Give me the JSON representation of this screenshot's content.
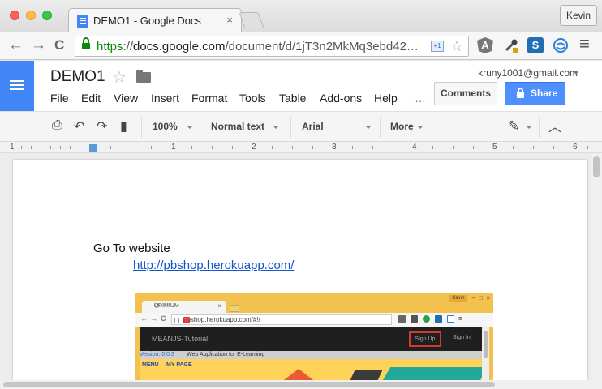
{
  "browser": {
    "tab_title": "DEMO1 - Google Docs",
    "tab_close": "×",
    "profile_name": "Kevin",
    "back_glyph": "←",
    "forward_glyph": "→",
    "reload_glyph": "C",
    "url_secure": "https",
    "url_sep": "://",
    "url_host": "docs.google.com",
    "url_path": "/document/d/1jT3n2MkMq3ebd42…",
    "omnibox_ext_label": "+1",
    "star_glyph": "☆",
    "extensions": [
      {
        "name": "angularjs-batarang",
        "label": "A",
        "color": "#7a7a7a"
      },
      {
        "name": "eyedropper",
        "label": "",
        "color": "#c9a227"
      },
      {
        "name": "scribefire",
        "label": "S",
        "color": "#1f6fb2"
      },
      {
        "name": "sync",
        "label": "",
        "color": "#2f7fd8"
      }
    ],
    "menu_glyph": "≡"
  },
  "docs": {
    "title": "DEMO1",
    "title_star": "☆",
    "menu": [
      "File",
      "Edit",
      "View",
      "Insert",
      "Format",
      "Tools",
      "Table",
      "Add-ons",
      "Help",
      "…"
    ],
    "account": "kruny1001@gmail.com",
    "comments_label": "Comments",
    "share_label": "Share",
    "colors": {
      "brand": "#4285f4",
      "share": "#4d90fe",
      "link": "#1155cc"
    }
  },
  "format_toolbar": {
    "print_glyph": "⎙",
    "undo_glyph": "↶",
    "redo_glyph": "↷",
    "paint_glyph": "▮",
    "zoom": "100%",
    "style": "Normal text",
    "font": "Arial",
    "more": "More",
    "pen_glyph": "✎",
    "collapse_glyph": "︿"
  },
  "ruler": {
    "numbers": [
      "1",
      "1",
      "2",
      "3",
      "4",
      "5",
      "6"
    ]
  },
  "document": {
    "line1": "Go To website",
    "link": "http://pbshop.herokuapp.com/"
  },
  "embedded_screenshot": {
    "tab_title": "URIMIUM",
    "tab_close": "×",
    "profile": "Kevin",
    "win_min": "–",
    "win_max": "□",
    "win_close": "×",
    "url": "pbshop.herokuapp.com/#!/",
    "brand": "MEANJS-Tutorial",
    "sign_up": "Sign Up",
    "sign_in": "Sign In",
    "version": "Version: 0.0.3",
    "description": "Web Application for E-Learning",
    "menu": [
      "MENU",
      "MY PAGE"
    ]
  }
}
